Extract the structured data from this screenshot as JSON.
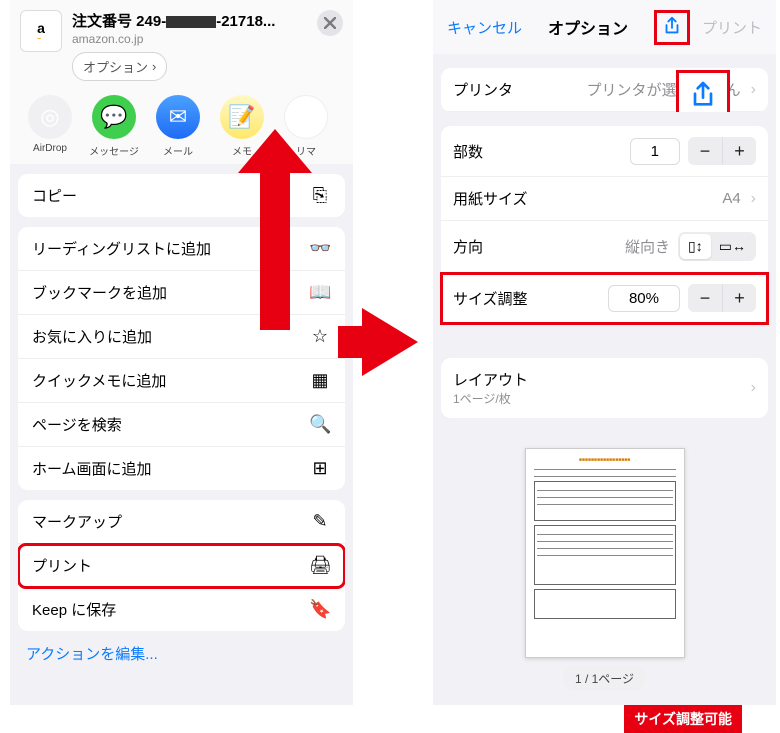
{
  "left": {
    "orderno_label": "注文番号 249-",
    "orderno_suffix": "-21718...",
    "domain": "amazon.co.jp",
    "site_letter": "a",
    "options_chip": "オプション",
    "share_targets": [
      {
        "label": "AirDrop"
      },
      {
        "label": "メッセージ"
      },
      {
        "label": "メール"
      },
      {
        "label": "メモ"
      },
      {
        "label": "リマ"
      }
    ],
    "g1": {
      "copy": "コピー"
    },
    "g2": {
      "reading": "リーディングリストに追加",
      "bookmark": "ブックマークを追加",
      "favorite": "お気に入りに追加",
      "quicknote": "クイックメモに追加",
      "find": "ページを検索",
      "homescreen": "ホーム画面に追加"
    },
    "g3": {
      "markup": "マークアップ",
      "print": "プリント",
      "keep": "Keep に保存"
    },
    "edit_actions": "アクションを編集..."
  },
  "right": {
    "cancel": "キャンセル",
    "title": "オプション",
    "print": "プリント",
    "printer_label": "プリンタ",
    "printer_value": "プリンタが選択さ         せん",
    "copies_label": "部数",
    "copies_value": "1",
    "paper_label": "用紙サイズ",
    "paper_value": "A4",
    "orient_label": "方向",
    "orient_value": "縦向き",
    "scale_label": "サイズ調整",
    "scale_value": "80%",
    "scale_banner": "サイズ調整可能",
    "layout_label": "レイアウト",
    "layout_sub": "1ページ/枚",
    "page_counter": "1 / 1ページ"
  }
}
